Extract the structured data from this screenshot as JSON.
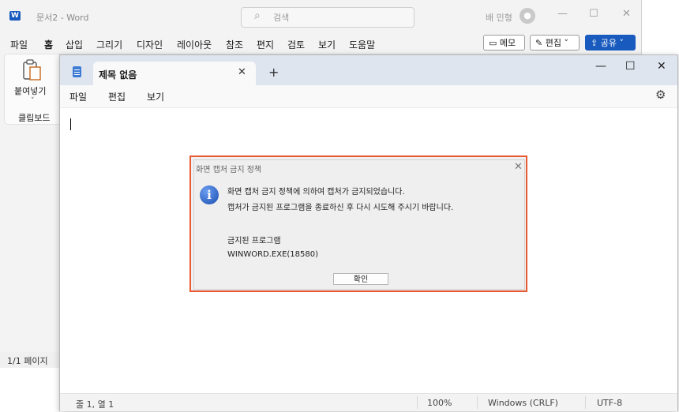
{
  "word": {
    "logo": "W",
    "title": "문서2 - Word",
    "search_placeholder": "검색",
    "user_name": "배 민형",
    "menu_tabs": [
      "파일",
      "홈",
      "삽입",
      "그리기",
      "디자인",
      "레이아웃",
      "참조",
      "편지",
      "검토",
      "보기",
      "도움말"
    ],
    "memo_label": "메모",
    "edit_label": "편집",
    "share_label": "공유",
    "paste_label": "붙여넣기",
    "clipboard_label": "클립보드",
    "page_status": "1/1 페이지"
  },
  "notepad": {
    "tab_title": "제목 없음",
    "menu": [
      "파일",
      "편집",
      "보기"
    ],
    "status": {
      "position": "줄 1, 열 1",
      "zoom": "100%",
      "line_ending": "Windows (CRLF)",
      "encoding": "UTF-8"
    }
  },
  "dialog": {
    "title": "화면 캡처 금지 정책",
    "message_line1": "화면 캡처 금지 정책에 의하여 캡처가 금지되었습니다.",
    "message_line2": "캡처가 금지된 프로그램을 종료하신 후 다시 시도해 주시기 바랍니다.",
    "blocked_heading": "금지된 프로그램",
    "blocked_program": "WINWORD.EXE(18580)",
    "ok_label": "확인",
    "highlight_color": "#e85a33"
  }
}
